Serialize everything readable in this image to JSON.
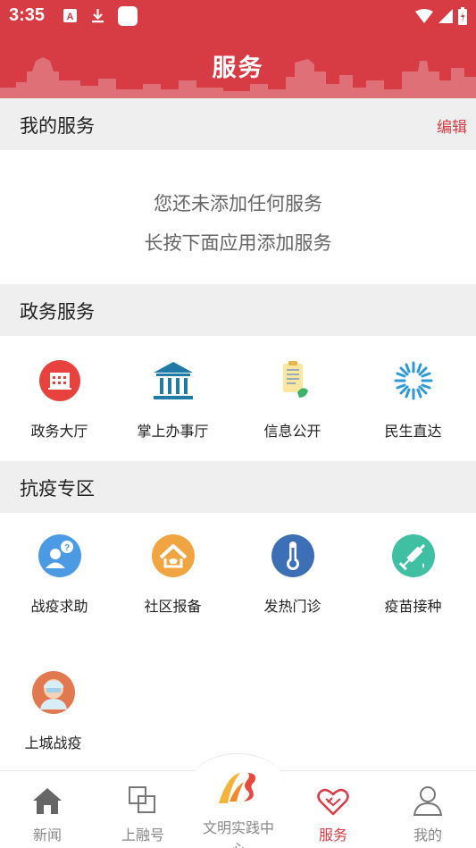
{
  "status_bar": {
    "time": "3:35"
  },
  "header": {
    "title": "服务"
  },
  "my_services": {
    "title": "我的服务",
    "edit_label": "编辑",
    "empty_line1": "您还未添加任何服务",
    "empty_line2": "长按下面应用添加服务"
  },
  "gov_services": {
    "title": "政务服务",
    "items": [
      {
        "label": "政务大厅",
        "icon": "government-hall-icon"
      },
      {
        "label": "掌上办事厅",
        "icon": "bank-building-icon"
      },
      {
        "label": "信息公开",
        "icon": "document-icon"
      },
      {
        "label": "民生直达",
        "icon": "sunburst-icon"
      }
    ]
  },
  "epidemic": {
    "title": "抗疫专区",
    "items": [
      {
        "label": "战疫求助",
        "icon": "help-person-icon"
      },
      {
        "label": "社区报备",
        "icon": "community-house-icon"
      },
      {
        "label": "发热门诊",
        "icon": "thermometer-icon"
      },
      {
        "label": "疫苗接种",
        "icon": "syringe-icon"
      },
      {
        "label": "上城战疫",
        "icon": "medical-worker-icon"
      }
    ]
  },
  "tabbar": {
    "items": [
      {
        "label": "新闻",
        "icon": "home-icon",
        "active": false
      },
      {
        "label": "上融号",
        "icon": "squares-icon",
        "active": false
      },
      {
        "label": "文明实践中心",
        "icon": "civilization-logo-icon",
        "active": false
      },
      {
        "label": "服务",
        "icon": "heart-hands-icon",
        "active": true
      },
      {
        "label": "我的",
        "icon": "person-icon",
        "active": false
      }
    ]
  },
  "colors": {
    "brand_red": "#d73b44",
    "section_bg": "#efefef"
  }
}
